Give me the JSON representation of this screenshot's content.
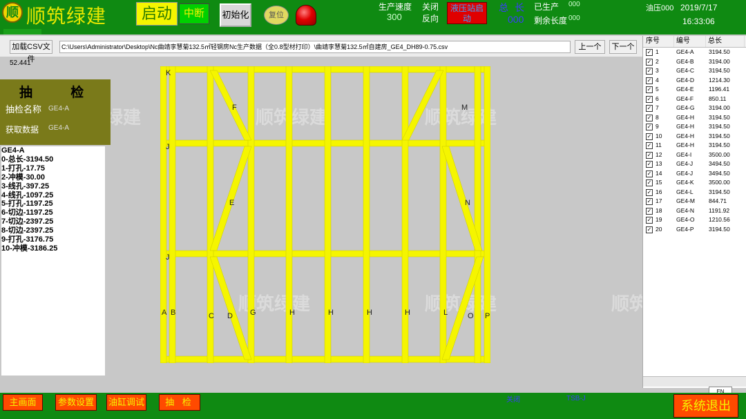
{
  "header": {
    "logo": "顺",
    "title": "顺筑绿建",
    "start": "启动",
    "interrupt": "中断",
    "init": "初始化",
    "reset": "复位",
    "speed_label": "生产速度",
    "speed_value": "300",
    "close_label": "关闭",
    "reverse_label": "反向",
    "hydraulic": "液压站启动",
    "total_length_label": "总长",
    "total_length_value": "000",
    "produced_label": "已生产",
    "produced_value": "000",
    "remaining_label": "剩余长度",
    "remaining_value": "000",
    "oil_label": "油压000",
    "date": "2019/7/17",
    "time": "16:33:06"
  },
  "toolbar": {
    "load_csv": "加载CSV文件",
    "path": "C:\\Users\\Administrator\\Desktop\\Nc曲靖李慧菊132.5㎡轻钢房Nc生产数据（全0.8型材打印）\\曲靖李慧菊132.5㎡自建房_GE4_DH89-0.75.csv",
    "prev": "上一个",
    "next": "下一个",
    "value": "52.441"
  },
  "inspect": {
    "title": "抽 检",
    "name_label": "抽检名称",
    "name_value": "GE4-A",
    "data_label": "获取数据",
    "data_value": "GE4-A",
    "lines": [
      "GE4-A",
      "0-总长-3194.50",
      "1-打孔-17.75",
      "2-冲模-30.00",
      "3-线孔-397.25",
      "4-线孔-1097.25",
      "5-打孔-1197.25",
      "6-切边-1197.25",
      "7-切边-2397.25",
      "8-切边-2397.25",
      "9-打孔-3176.75",
      "10-冲模-3186.25"
    ]
  },
  "drawing": {
    "labels": [
      "K",
      "F",
      "M",
      "J",
      "E",
      "N",
      "J",
      "A",
      "B",
      "C",
      "D",
      "G",
      "H",
      "H",
      "H",
      "H",
      "L",
      "O",
      "P",
      "I"
    ]
  },
  "table": {
    "headers": [
      "序号",
      "编号",
      "总长"
    ],
    "rows": [
      [
        "1",
        "GE4-A",
        "3194.50"
      ],
      [
        "2",
        "GE4-B",
        "3194.00"
      ],
      [
        "3",
        "GE4-C",
        "3194.50"
      ],
      [
        "4",
        "GE4-D",
        "1214.30"
      ],
      [
        "5",
        "GE4-E",
        "1196.41"
      ],
      [
        "6",
        "GE4-F",
        "850.11"
      ],
      [
        "7",
        "GE4-G",
        "3194.00"
      ],
      [
        "8",
        "GE4-H",
        "3194.50"
      ],
      [
        "9",
        "GE4-H",
        "3194.50"
      ],
      [
        "10",
        "GE4-H",
        "3194.50"
      ],
      [
        "11",
        "GE4-H",
        "3194.50"
      ],
      [
        "12",
        "GE4-I",
        "3500.00"
      ],
      [
        "13",
        "GE4-J",
        "3494.50"
      ],
      [
        "14",
        "GE4-J",
        "3494.50"
      ],
      [
        "15",
        "GE4-K",
        "3500.00"
      ],
      [
        "16",
        "GE4-L",
        "3194.50"
      ],
      [
        "17",
        "GE4-M",
        "844.71"
      ],
      [
        "18",
        "GE4-N",
        "1191.92"
      ],
      [
        "19",
        "GE4-O",
        "1210.56"
      ],
      [
        "20",
        "GE4-P",
        "3194.50"
      ]
    ],
    "lang": "EN"
  },
  "footer": {
    "main": "主画面",
    "params": "参数设置",
    "cylinder": "油缸调试",
    "inspect": "抽 检",
    "close_status": "关闭",
    "plc": "TSB-J",
    "exit": "系统退出"
  },
  "watermark": "顺筑绿建",
  "colors": {
    "header_green": "#0f8a12",
    "frame_yellow": "#f5f500",
    "button_orange": "#ff4a00"
  }
}
